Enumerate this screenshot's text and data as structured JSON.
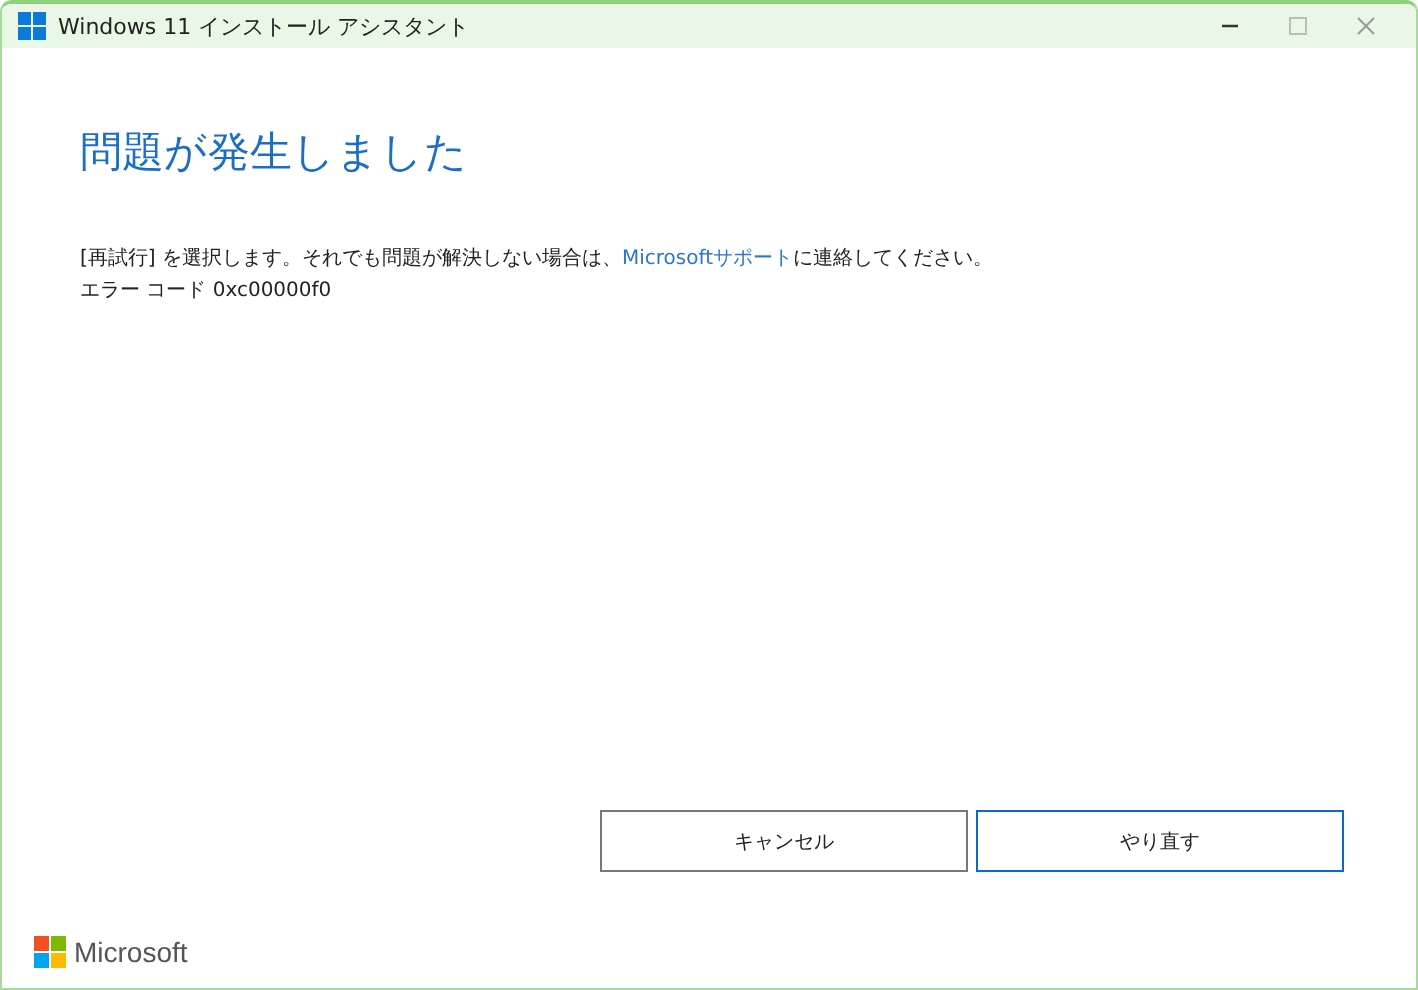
{
  "window": {
    "title": "Windows 11 インストール アシスタント"
  },
  "heading": "問題が発生しました",
  "message": {
    "before": "[再試行] を選択します。それでも問題が解決しない場合は、",
    "link": "Microsoftサポート",
    "after": "に連絡してください。"
  },
  "error_line": "エラー コード 0xc00000f0",
  "buttons": [
    {
      "label": "キャンセル",
      "default": false
    },
    {
      "label": "やり直す",
      "default": true
    }
  ],
  "footer": {
    "logo_text": "Microsoft"
  }
}
